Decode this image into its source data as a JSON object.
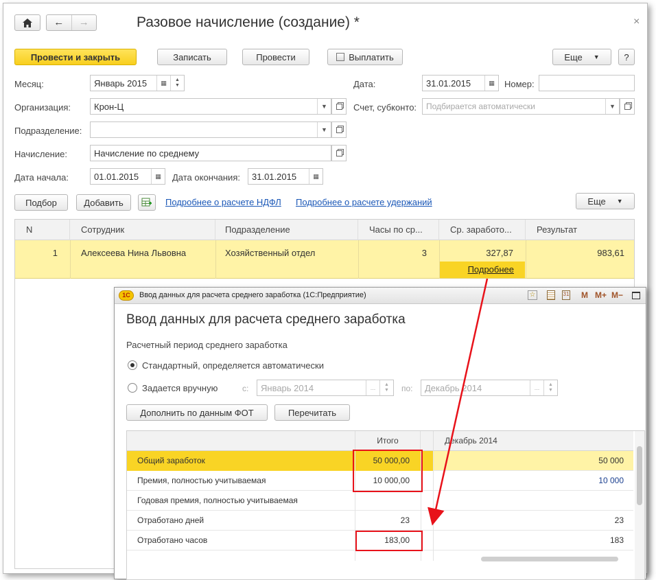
{
  "window": {
    "title": "Разовое начисление (создание) *",
    "close_glyph": "×"
  },
  "toolbar": {
    "post_close": "Провести и закрыть",
    "save": "Записать",
    "post": "Провести",
    "pay": "Выплатить",
    "more": "Еще",
    "help": "?"
  },
  "form": {
    "month_label": "Месяц:",
    "month_value": "Январь 2015",
    "date_label": "Дата:",
    "date_value": "31.01.2015",
    "number_label": "Номер:",
    "number_value": "",
    "org_label": "Организация:",
    "org_value": "Крон-Ц",
    "account_label": "Счет, субконто:",
    "account_placeholder": "Подбирается автоматически",
    "dept_label": "Подразделение:",
    "dept_value": "",
    "accrual_label": "Начисление:",
    "accrual_value": "Начисление по среднему",
    "start_label": "Дата начала:",
    "start_value": "01.01.2015",
    "end_label": "Дата окончания:",
    "end_value": "31.01.2015"
  },
  "table_toolbar": {
    "select": "Подбор",
    "add": "Добавить",
    "ndfl_link": "Подробнее о расчете НДФЛ",
    "deduct_link": "Подробнее о расчете удержаний",
    "more": "Еще"
  },
  "table": {
    "columns": [
      "N",
      "Сотрудник",
      "Подразделение",
      "Часы по ср...",
      "Ср. заработо...",
      "Результат"
    ],
    "rows": [
      {
        "n": "1",
        "employee": "Алексеева Нина Львовна",
        "dept": "Хозяйственный отдел",
        "hours": "3",
        "avg": "327,87",
        "result": "983,61"
      }
    ],
    "details_link": "Подробнее"
  },
  "dialog": {
    "window_title": "Ввод данных для расчета среднего заработка  (1С:Предприятие)",
    "heading": "Ввод данных для расчета среднего заработка",
    "period_label": "Расчетный период среднего заработка",
    "option_standard": "Стандартный, определяется автоматически",
    "option_manual": "Задается вручную",
    "from_label": "с:",
    "from_value": "Январь 2014",
    "to_label": "по:",
    "to_value": "Декабрь 2014",
    "btn_fill": "Дополнить по данным ФОТ",
    "btn_recalc": "Перечитать",
    "tb_icons": [
      "M",
      "M+",
      "M−"
    ],
    "grid": {
      "col_total": "Итого",
      "col_month": "Декабрь 2014",
      "rows": [
        {
          "label": "Общий заработок",
          "total": "50 000,00",
          "month": "50 000"
        },
        {
          "label": "Премия, полностью учитываемая",
          "total": "10 000,00",
          "month": "10 000"
        },
        {
          "label": "Годовая премия, полностью учитываемая",
          "total": "",
          "month": ""
        },
        {
          "label": "Отработано дней",
          "total": "23",
          "month": "23"
        },
        {
          "label": "Отработано часов",
          "total": "183,00",
          "month": "183"
        }
      ]
    }
  },
  "colors": {
    "accent_yellow": "#fbe27a",
    "selected_row": "#fff3a6",
    "link": "#1a57b7",
    "annotation_red": "#e8121a"
  }
}
